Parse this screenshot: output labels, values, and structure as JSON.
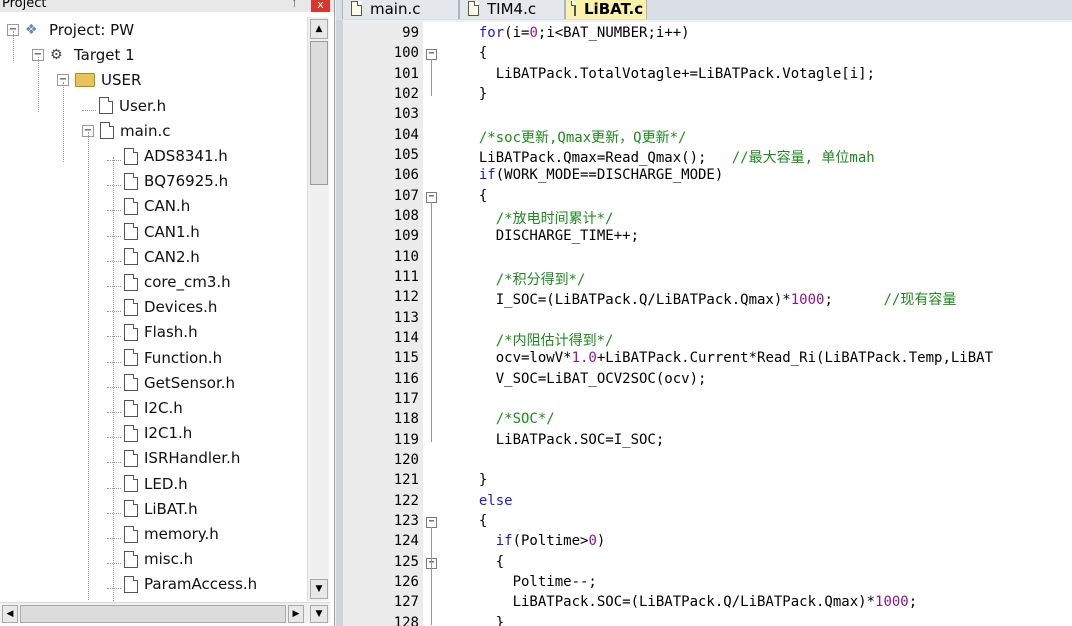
{
  "project_panel": {
    "title": "Project",
    "pin": "ᛘ",
    "close": "x",
    "tree": [
      {
        "label": "Project: PW",
        "type": "project",
        "expander": "−"
      },
      {
        "label": "Target 1",
        "type": "target",
        "expander": "−"
      },
      {
        "label": "USER",
        "type": "folder",
        "expander": "−"
      },
      {
        "label": "User.h",
        "type": "file"
      },
      {
        "label": "main.c",
        "type": "file",
        "expander": "−"
      },
      {
        "label": "ADS8341.h",
        "type": "file"
      },
      {
        "label": "BQ76925.h",
        "type": "file"
      },
      {
        "label": "CAN.h",
        "type": "file"
      },
      {
        "label": "CAN1.h",
        "type": "file"
      },
      {
        "label": "CAN2.h",
        "type": "file"
      },
      {
        "label": "core_cm3.h",
        "type": "file"
      },
      {
        "label": "Devices.h",
        "type": "file"
      },
      {
        "label": "Flash.h",
        "type": "file"
      },
      {
        "label": "Function.h",
        "type": "file"
      },
      {
        "label": "GetSensor.h",
        "type": "file"
      },
      {
        "label": "I2C.h",
        "type": "file"
      },
      {
        "label": "I2C1.h",
        "type": "file"
      },
      {
        "label": "ISRHandler.h",
        "type": "file"
      },
      {
        "label": "LED.h",
        "type": "file"
      },
      {
        "label": "LiBAT.h",
        "type": "file"
      },
      {
        "label": "memory.h",
        "type": "file"
      },
      {
        "label": "misc.h",
        "type": "file"
      },
      {
        "label": "ParamAccess.h",
        "type": "file"
      }
    ],
    "scroll_up": "▲",
    "scroll_down": "▼",
    "scroll_left": "◀",
    "scroll_right": "▶"
  },
  "tabs": [
    {
      "label": "main.c",
      "active": false
    },
    {
      "label": "TIM4.c",
      "active": false
    },
    {
      "label": "LiBAT.c",
      "active": true
    }
  ],
  "editor": {
    "lines": [
      {
        "n": "99",
        "fold": "",
        "code": "  for(i=0;i<BAT_NUMBER;i++)"
      },
      {
        "n": "100",
        "fold": "−",
        "code": "  {"
      },
      {
        "n": "101",
        "fold": "",
        "code": "    LiBATPack.TotalVotagle+=LiBATPack.Votagle[i];"
      },
      {
        "n": "102",
        "fold": "",
        "code": "  }"
      },
      {
        "n": "103",
        "fold": "",
        "code": ""
      },
      {
        "n": "104",
        "fold": "",
        "code": "  /*soc更新,Qmax更新，Q更新*/"
      },
      {
        "n": "105",
        "fold": "",
        "code": "  LiBATPack.Qmax=Read_Qmax();   //最大容量, 单位mah"
      },
      {
        "n": "106",
        "fold": "",
        "code": "  if(WORK_MODE==DISCHARGE_MODE)"
      },
      {
        "n": "107",
        "fold": "−",
        "code": "  {"
      },
      {
        "n": "108",
        "fold": "",
        "code": "    /*放电时间累计*/"
      },
      {
        "n": "109",
        "fold": "",
        "code": "    DISCHARGE_TIME++;"
      },
      {
        "n": "110",
        "fold": "",
        "code": ""
      },
      {
        "n": "111",
        "fold": "",
        "code": "    /*积分得到*/"
      },
      {
        "n": "112",
        "fold": "",
        "code": "    I_SOC=(LiBATPack.Q/LiBATPack.Qmax)*1000;      //现有容量"
      },
      {
        "n": "113",
        "fold": "",
        "code": ""
      },
      {
        "n": "114",
        "fold": "",
        "code": "    /*内阻估计得到*/"
      },
      {
        "n": "115",
        "fold": "",
        "code": "    ocv=lowV*1.0+LiBATPack.Current*Read_Ri(LiBATPack.Temp,LiBAT"
      },
      {
        "n": "116",
        "fold": "",
        "code": "    V_SOC=LiBAT_OCV2SOC(ocv);"
      },
      {
        "n": "117",
        "fold": "",
        "code": ""
      },
      {
        "n": "118",
        "fold": "",
        "code": "    /*SOC*/"
      },
      {
        "n": "119",
        "fold": "",
        "code": "    LiBATPack.SOC=I_SOC;"
      },
      {
        "n": "120",
        "fold": "",
        "code": ""
      },
      {
        "n": "121",
        "fold": "",
        "code": "  }"
      },
      {
        "n": "122",
        "fold": "",
        "code": "  else"
      },
      {
        "n": "123",
        "fold": "−",
        "code": "  {"
      },
      {
        "n": "124",
        "fold": "",
        "code": "    if(Poltime>0)"
      },
      {
        "n": "125",
        "fold": "−",
        "code": "    {"
      },
      {
        "n": "126",
        "fold": "",
        "code": "      Poltime--;"
      },
      {
        "n": "127",
        "fold": "",
        "code": "      LiBATPack.SOC=(LiBATPack.Q/LiBATPack.Qmax)*1000;"
      },
      {
        "n": "128",
        "fold": "",
        "code": "    }"
      }
    ]
  },
  "colors": {
    "keyword": "#1b1bd3",
    "number": "#8a1a8a",
    "comment": "#1e8a1e",
    "active_tab": "#fbf3a8"
  }
}
